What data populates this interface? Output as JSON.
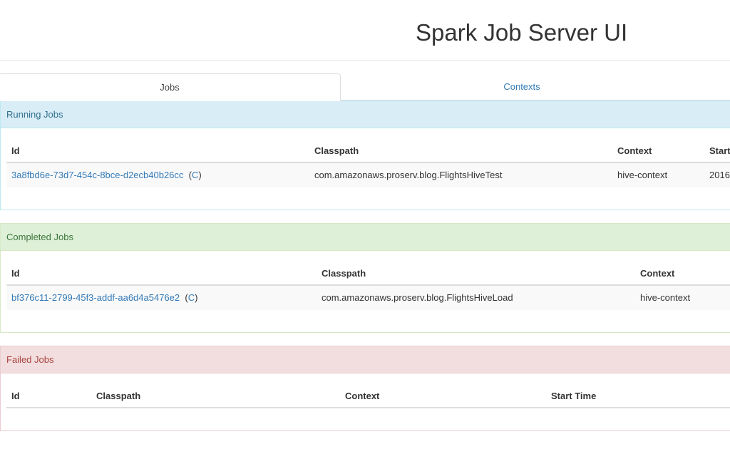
{
  "app": {
    "title": "Spark Job Server UI"
  },
  "tabs": [
    {
      "label": "Jobs",
      "active": true
    },
    {
      "label": "Contexts",
      "active": false
    }
  ],
  "running": {
    "heading": "Running Jobs",
    "columns": [
      "Id",
      "Classpath",
      "Context",
      "Start"
    ],
    "rows": [
      {
        "id": "3a8fbd6e-73d7-454c-8bce-d2ecb40b26cc",
        "action": "C",
        "classpath": "com.amazonaws.proserv.blog.FlightsHiveTest",
        "context": "hive-context",
        "start": "2016"
      }
    ]
  },
  "completed": {
    "heading": "Completed Jobs",
    "columns": [
      "Id",
      "Classpath",
      "Context"
    ],
    "rows": [
      {
        "id": "bf376c11-2799-45f3-addf-aa6d4a5476e2",
        "action": "C",
        "classpath": "com.amazonaws.proserv.blog.FlightsHiveLoad",
        "context": "hive-context"
      }
    ]
  },
  "failed": {
    "heading": "Failed Jobs",
    "columns": [
      "Id",
      "Classpath",
      "Context",
      "Start Time"
    ],
    "rows": []
  },
  "colors": {
    "link": "#337ab7",
    "info_bg": "#d9edf7",
    "success_bg": "#dff0d8",
    "danger_bg": "#f2dede"
  }
}
